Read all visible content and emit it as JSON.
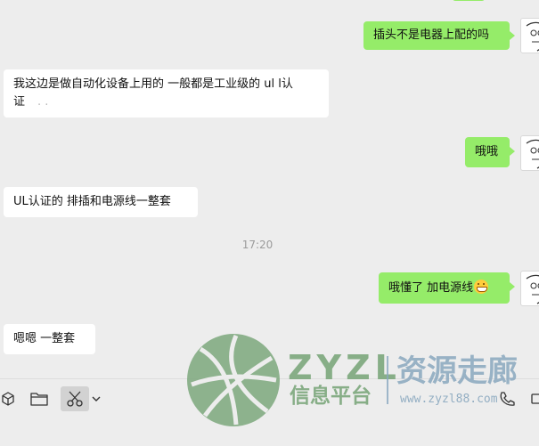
{
  "messages": [
    {
      "id": "m1",
      "side": "out",
      "text": "插头不是电器上配的吗"
    },
    {
      "id": "m2",
      "side": "in",
      "line1": "我这边是做自动化设备上用的  一般都是工业级的 ul l认",
      "line2": "证",
      "line2_faint": ".     ."
    },
    {
      "id": "m3",
      "side": "out",
      "text": "哦哦"
    },
    {
      "id": "m4",
      "side": "in",
      "text": "UL认证的  排插和电源线一整套"
    },
    {
      "id": "m5",
      "side": "out",
      "text": "哦懂了 加电源线",
      "emoji": "grinning-face-emoji"
    },
    {
      "id": "m6",
      "side": "in",
      "text": "嗯嗯  一整套"
    }
  ],
  "timestamp": "17:20",
  "toolbar": {
    "icons": [
      "cube-icon",
      "folder-icon",
      "scissors-icon",
      "chevron-down-icon",
      "phone-icon",
      "video-icon"
    ]
  },
  "watermark": {
    "brand": "ZYZL",
    "tagline": "资源走廊",
    "subtitle": "信息平台",
    "url": "www.zyzl88.com",
    "colors": {
      "logo": "#7da87d",
      "text": "#8aa8bf"
    }
  },
  "colors": {
    "background": "#ededed",
    "outgoing_bubble": "#95ec69",
    "incoming_bubble": "#ffffff"
  }
}
